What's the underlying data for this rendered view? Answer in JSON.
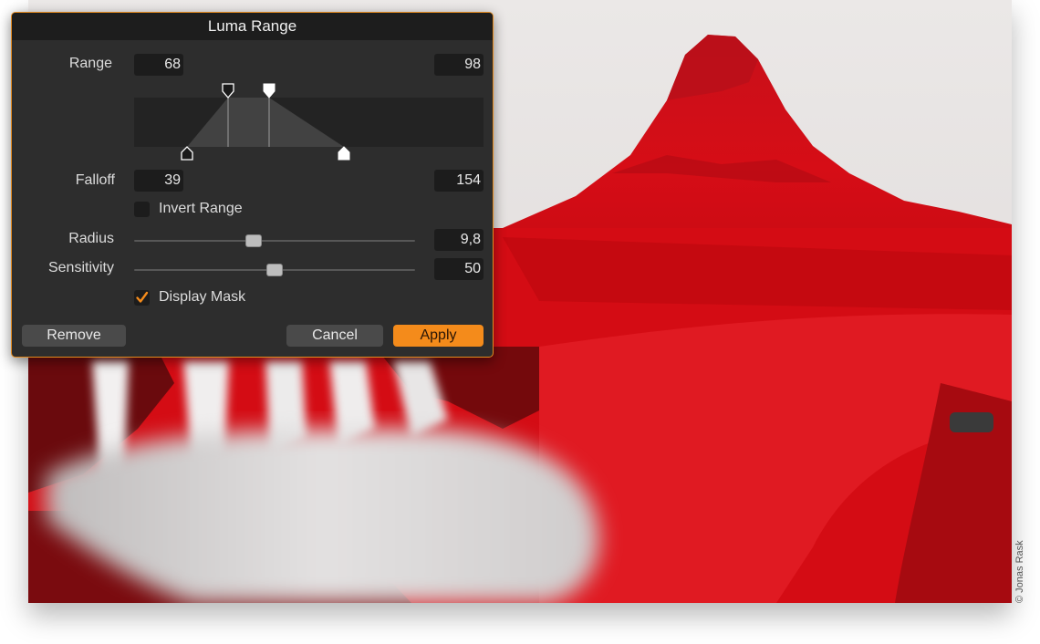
{
  "dialog": {
    "title": "Luma Range",
    "range": {
      "label": "Range",
      "min": "68",
      "max": "98"
    },
    "falloff": {
      "label": "Falloff",
      "min": "39",
      "max": "154"
    },
    "invert_range": {
      "label": "Invert Range",
      "checked": false
    },
    "radius": {
      "label": "Radius",
      "value": "9,8",
      "level": 0.42
    },
    "sensitivity": {
      "label": "Sensitivity",
      "value": "50",
      "level": 0.5
    },
    "display_mask": {
      "label": "Display Mask",
      "checked": true
    },
    "buttons": {
      "remove": "Remove",
      "cancel": "Cancel",
      "apply": "Apply"
    }
  },
  "photo": {
    "credit": "© Jonas Rask",
    "mask_color": "#d8000c"
  },
  "colors": {
    "accent": "#f48b1b",
    "dialog_bg": "#2d2d2d"
  }
}
